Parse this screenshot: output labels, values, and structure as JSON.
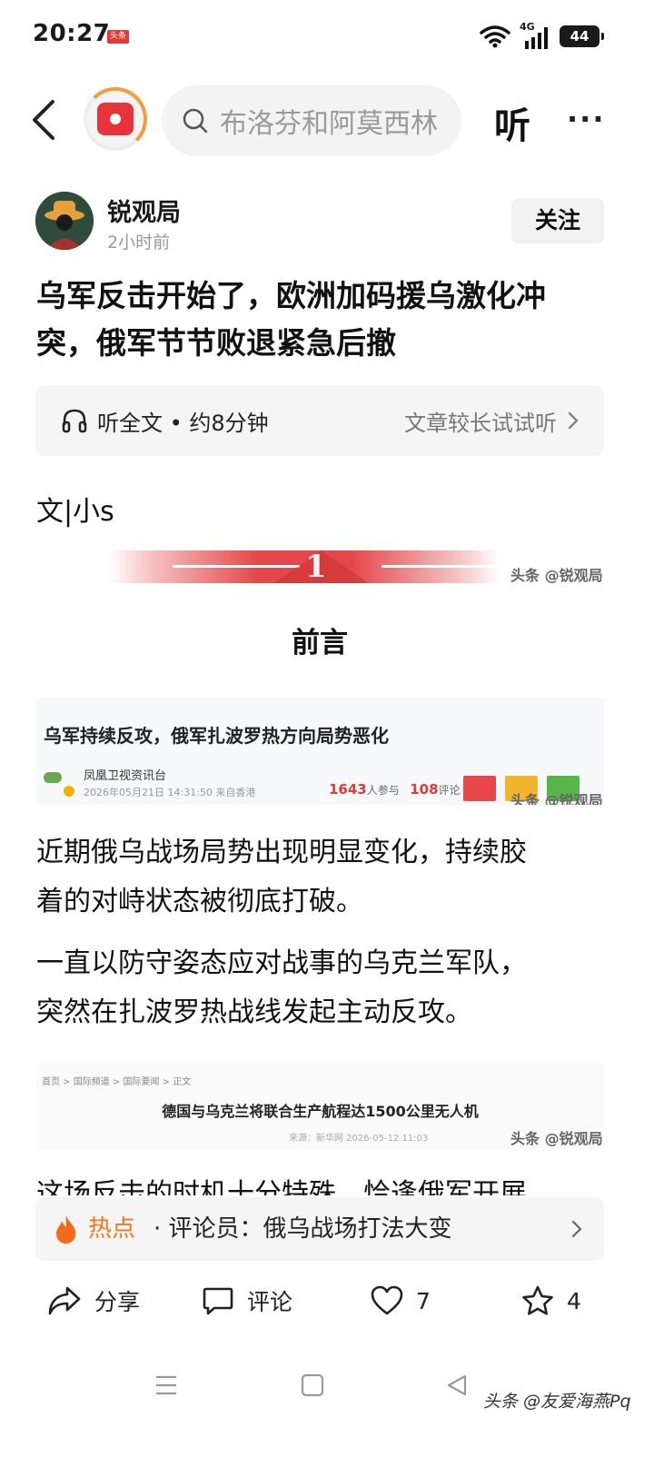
{
  "status_bar": {
    "time": "20:27",
    "app_badge": "头条",
    "network": "4G",
    "battery": "44"
  },
  "top_nav": {
    "search_placeholder": "布洛芬和阿莫西林",
    "listen_label": "听",
    "more_label": "···"
  },
  "author": {
    "name": "锐观局",
    "time": "2小时前",
    "follow_label": "关注"
  },
  "article": {
    "title_line1": "乌军反击开始了，欧洲加码援乌激化冲",
    "title_line2": "突，俄军节节败退紧急后撤",
    "listen_left": "听全文 • 约8分钟",
    "listen_right": "文章较长试试听",
    "byline": "文|小s",
    "banner_number": "1",
    "watermark": "头条 @锐观局",
    "section_heading": "前言",
    "card1": {
      "title": "乌军持续反攻，俄军扎波罗热方向局势恶化",
      "source": "凤凰卫视资讯台",
      "meta": "2026年05月21日 14:31:50 来自香港",
      "participants": "1643",
      "participants_label": "人参与",
      "comments": "108",
      "comments_label": "评论"
    },
    "para1_line1": "近期俄乌战场局势出现明显变化，持续胶",
    "para1_line2": "着的对峙状态被彻底打破。",
    "para2_line1": "一直以防守姿态应对战事的乌克兰军队，",
    "para2_line2": "突然在扎波罗热战线发起主动反攻。",
    "card2": {
      "breadcrumb": "首页 > 国际频道 > 国际要闻 > 正文",
      "title": "德国与乌克兰将联合生产航程达1500公里无人机",
      "meta": "来源：新华网 2026-05-12 11:03"
    },
    "clipped_para": "这场反击的时机十分特殊，恰逢俄军开展"
  },
  "hot_bar": {
    "label": "热点",
    "text": "· 评论员：俄乌战场打法大变"
  },
  "actions": {
    "share": "分享",
    "comment": "评论",
    "like_count": "7",
    "favorite_count": "4"
  },
  "bottom_watermark": "头条 @友爱海燕Pq",
  "colors": {
    "accent_orange": "#f07818",
    "brand_red": "#e8333b"
  }
}
